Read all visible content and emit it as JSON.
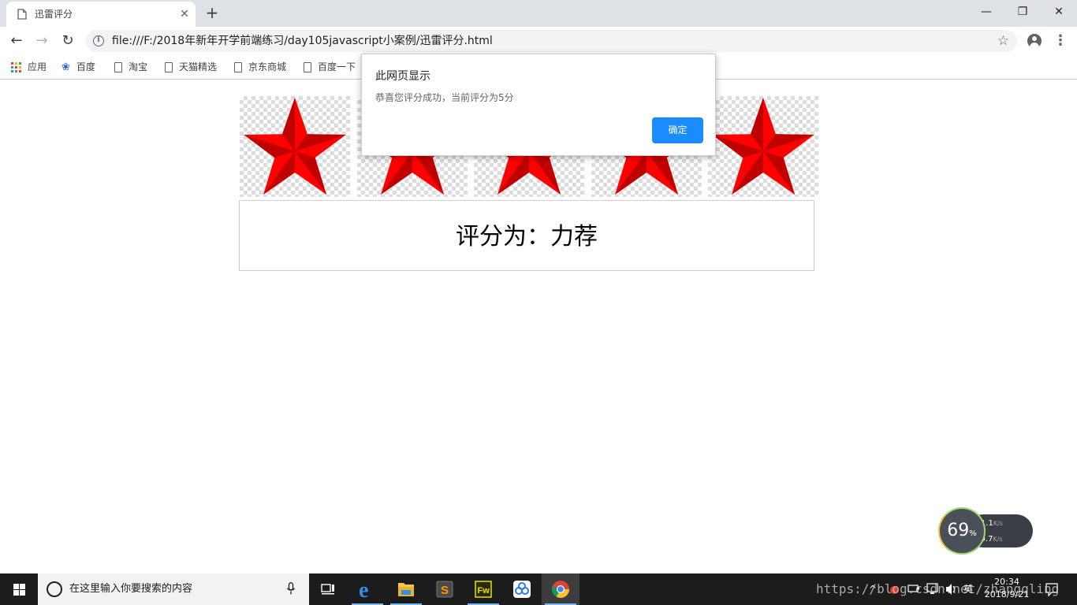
{
  "tab": {
    "title": "迅雷评分"
  },
  "window": {
    "minimize": "—",
    "restore": "❐",
    "close": "✕"
  },
  "toolbar": {
    "back": "←",
    "forward": "→",
    "reload": "↻",
    "url": "file:///F:/2018年新年开学前端练习/day105javascript小案例/迅雷评分.html",
    "bookmark_star": "☆",
    "menu": "⋮"
  },
  "bookmarks": [
    {
      "label": "应用",
      "icon": "apps-grid-icon"
    },
    {
      "label": "百度",
      "icon": "baidu-paw-icon"
    },
    {
      "label": "淘宝",
      "icon": "page-icon"
    },
    {
      "label": "天猫精选",
      "icon": "page-icon"
    },
    {
      "label": "京东商城",
      "icon": "page-icon"
    },
    {
      "label": "百度一下",
      "icon": "page-icon"
    }
  ],
  "rating": {
    "rating_value": 5,
    "max_rating": 5,
    "result_text": "评分为：力荐",
    "star_color": "#ff0000"
  },
  "dialog": {
    "title": "此网页显示",
    "message": "恭喜您评分成功，当前评分为5分",
    "ok_label": "确定",
    "ok_color": "#1a8cff"
  },
  "network": {
    "usage": "69",
    "usage_unit": "%",
    "upload": "41.1",
    "download": "0.7",
    "speed_unit": "K/s"
  },
  "taskbar": {
    "search_placeholder": "在这里输入你要搜索的内容",
    "ime": "英",
    "time": "20:34",
    "date": "2018/9/21",
    "tray_chevron": "^",
    "apps": [
      "task-view",
      "edge",
      "file-explorer",
      "sublime-text",
      "fireworks",
      "baidu-netdisk",
      "chrome"
    ]
  },
  "watermark": "https://blog.csdn.net/zhangqling"
}
